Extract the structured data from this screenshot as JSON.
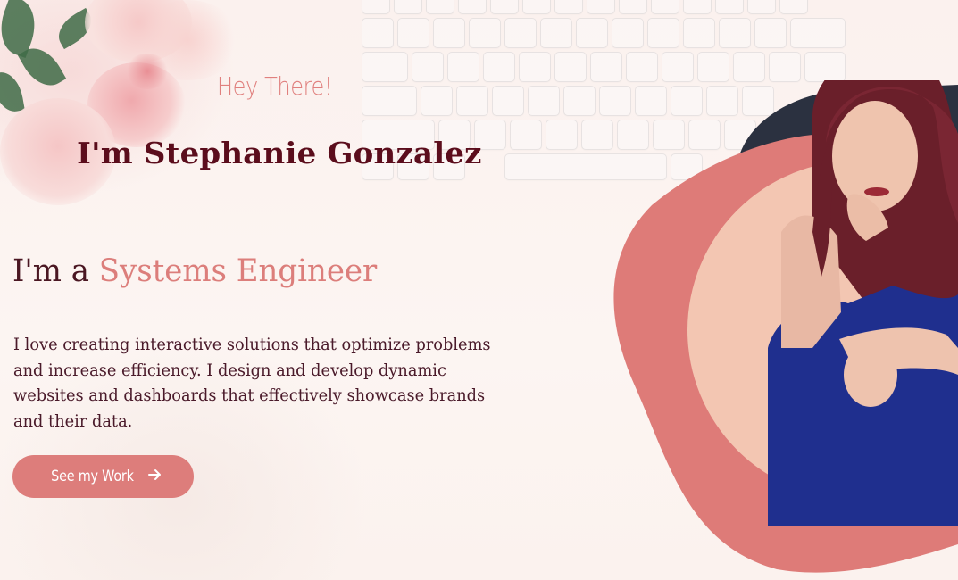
{
  "hero": {
    "greeting": "Hey There!",
    "name": "I'm Stephanie Gonzalez",
    "role_prefix": "I'm a ",
    "role_title": "Systems Engineer",
    "description": "I love creating interactive solutions that optimize problems and increase efficiency. I design and develop dynamic websites and dashboards that effectively showcase brands and their data.",
    "cta_label": "See my Work",
    "cta_icon": "arrow-right-icon"
  },
  "colors": {
    "accent": "#dd7d7b",
    "name_text": "#5b0d1c",
    "body_text": "#4a1a2a",
    "background": "#fbf3ef",
    "navy_blob": "#2b3140",
    "peach_circle": "#f2c7b3",
    "dress": "#1f2f8e"
  }
}
